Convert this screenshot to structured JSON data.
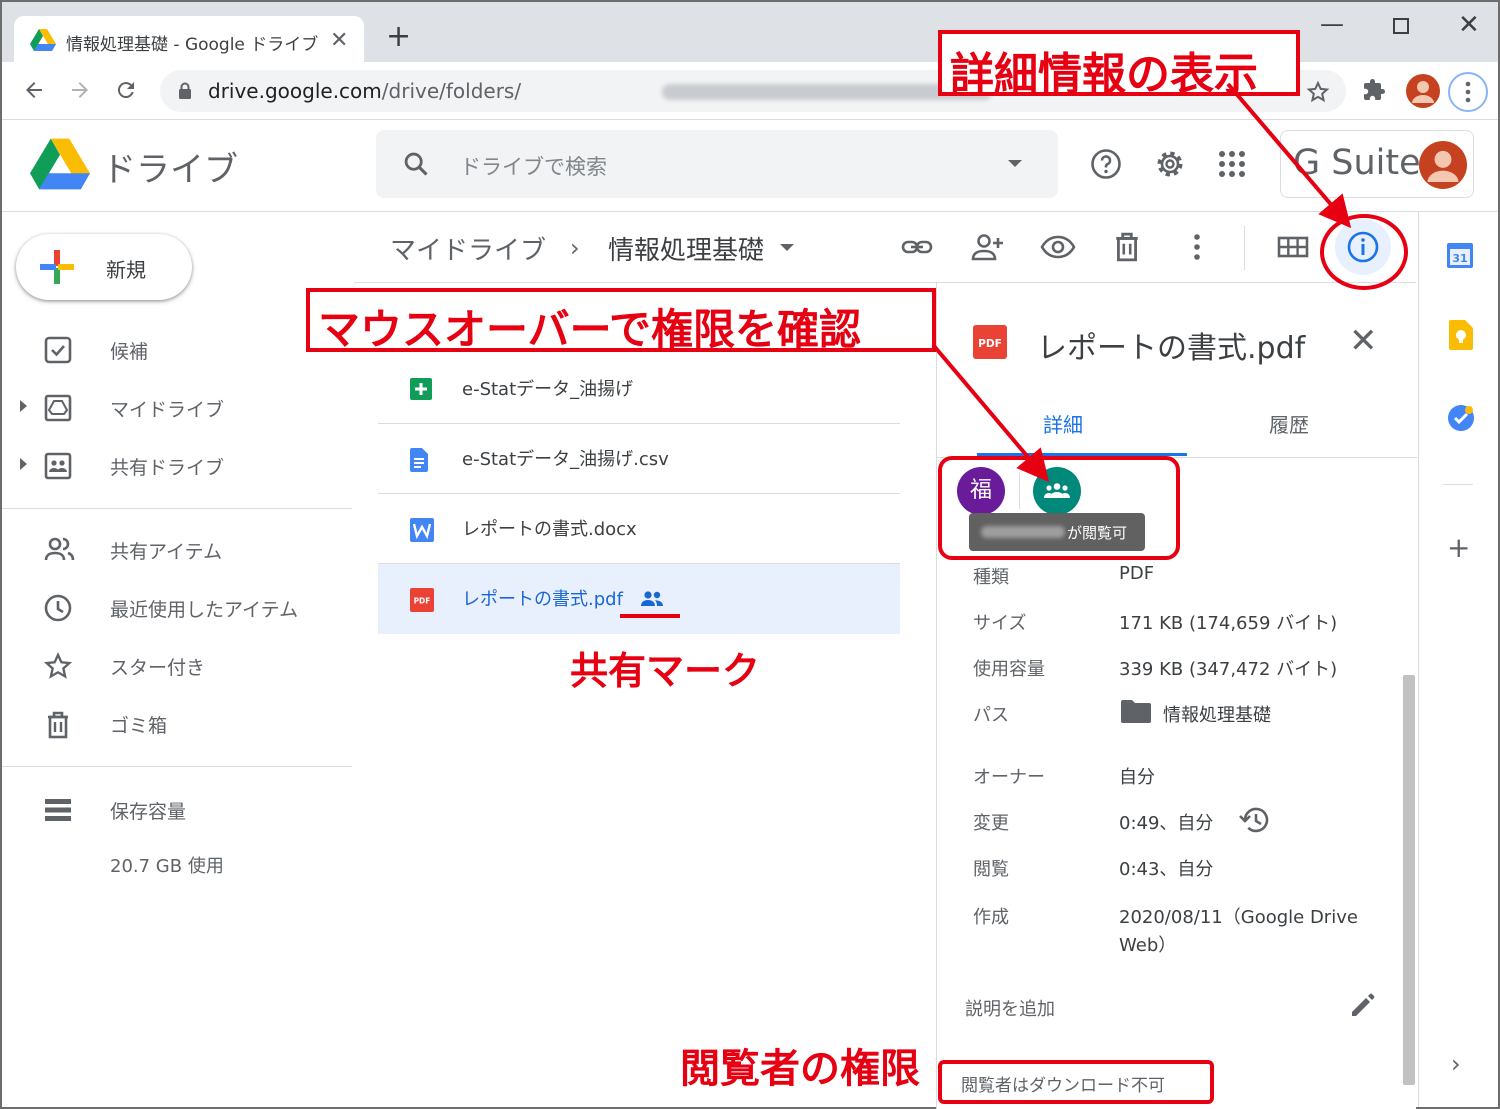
{
  "browser": {
    "tab_title": "情報処理基礎 - Google ドライブ",
    "tab_close": "✕",
    "new_tab": "+",
    "url_host": "drive.google.com",
    "url_path": "/drive/folders/"
  },
  "drive": {
    "product_name": "ドライブ",
    "search_placeholder": "ドライブで検索",
    "suite_label": "G Suite"
  },
  "sidebar": {
    "new_label": "新規",
    "items": [
      {
        "label": "候補"
      },
      {
        "label": "マイドライブ"
      },
      {
        "label": "共有ドライブ"
      },
      {
        "label": "共有アイテム"
      },
      {
        "label": "最近使用したアイテム"
      },
      {
        "label": "スター付き"
      },
      {
        "label": "ゴミ箱"
      },
      {
        "label": "保存容量"
      }
    ],
    "storage_used": "20.7 GB 使用"
  },
  "breadcrumb": {
    "root": "マイドライブ",
    "separator": "›",
    "current": "情報処理基礎"
  },
  "files": [
    {
      "name": "e-Statデータ_油揚げ",
      "type": "sheets"
    },
    {
      "name": "e-Statデータ_油揚げ.csv",
      "type": "docs"
    },
    {
      "name": "レポートの書式.docx",
      "type": "word"
    },
    {
      "name": "レポートの書式.pdf",
      "type": "pdf",
      "selected": true,
      "shared": true
    }
  ],
  "details": {
    "title": "レポートの書式.pdf",
    "close": "✕",
    "tab_details": "詳細",
    "tab_history": "履歴",
    "owner_avatar_letter": "福",
    "tooltip_text": "が閲覧可",
    "properties": [
      {
        "label": "種類",
        "value": "PDF"
      },
      {
        "label": "サイズ",
        "value": "171 KB (174,659 バイト)"
      },
      {
        "label": "使用容量",
        "value": "339 KB (347,472 バイト)"
      },
      {
        "label": "パス",
        "value": "情報処理基礎"
      },
      {
        "label": "オーナー",
        "value": "自分"
      },
      {
        "label": "変更",
        "value": "0:49、自分"
      },
      {
        "label": "閲覧",
        "value": "0:43、自分"
      },
      {
        "label": "作成",
        "value": "2020/08/11（Google Drive",
        "value2": "Web）"
      }
    ],
    "description_add": "説明を追加",
    "viewer_permission": "閲覧者はダウンロード不可"
  },
  "annotations": {
    "details_view": "詳細情報の表示",
    "mouseover_check": "マウスオーバーで権限を確認",
    "share_mark": "共有マーク",
    "viewer_permission": "閲覧者の権限"
  },
  "colors": {
    "annotation_red": "#e60012",
    "drive_blue": "#1a73e8",
    "selected_row": "#e8f0fe"
  }
}
